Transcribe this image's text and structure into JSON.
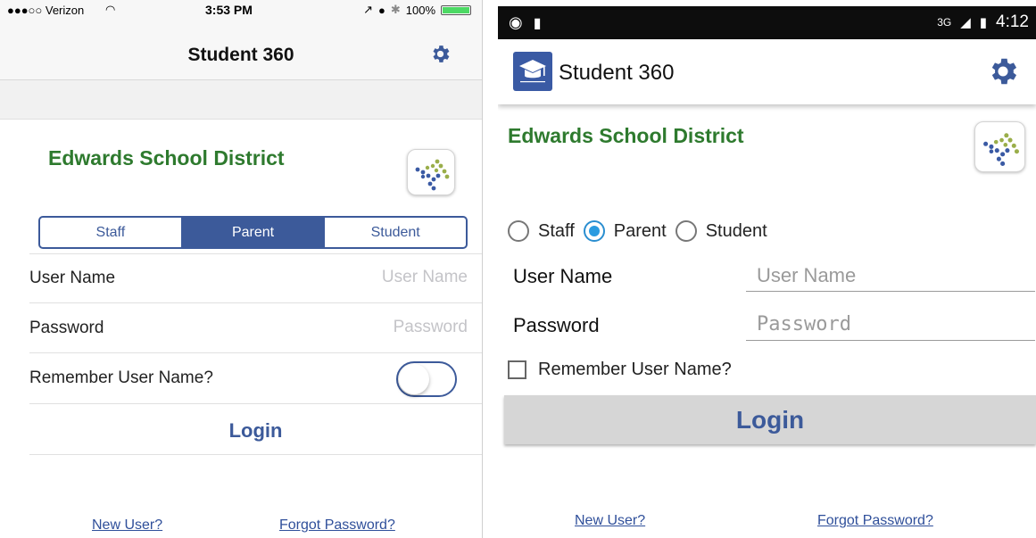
{
  "ios": {
    "status": {
      "carrier": "●●●○○ Verizon",
      "time": "3:53 PM",
      "battery": "100%",
      "battery_level": 1.0
    },
    "nav_title": "Student 360",
    "district": "Edwards School District",
    "roles": [
      "Staff",
      "Parent",
      "Student"
    ],
    "selected_role": "Parent",
    "username_label": "User Name",
    "username_placeholder": "User Name",
    "password_label": "Password",
    "password_placeholder": "Password",
    "remember_label": "Remember User Name?",
    "remember_on": false,
    "login": "Login",
    "new_user": "New User?",
    "forgot_password": "Forgot Password?"
  },
  "android": {
    "status": {
      "network": "3G",
      "time": "4:12"
    },
    "app_title": "Student 360",
    "district": "Edwards School District",
    "roles": [
      "Staff",
      "Parent",
      "Student"
    ],
    "selected_role": "Parent",
    "username_label": "User Name",
    "username_placeholder": "User Name",
    "password_label": "Password",
    "password_placeholder": "Password",
    "remember_label": "Remember User Name?",
    "remember_checked": false,
    "login": "Login",
    "new_user": "New User?",
    "forgot_password": "Forgot Password?"
  },
  "colors": {
    "accent": "#3c5a9a",
    "district_green": "#2e7a2e",
    "android_radio": "#2a9be0",
    "logo_blue": "#3a5aa4",
    "logo_green": "#9aae4a"
  },
  "icons": [
    "gear-icon",
    "district-logo-icon",
    "app-icon",
    "wifi-icon",
    "battery-icon",
    "signal-icon"
  ]
}
